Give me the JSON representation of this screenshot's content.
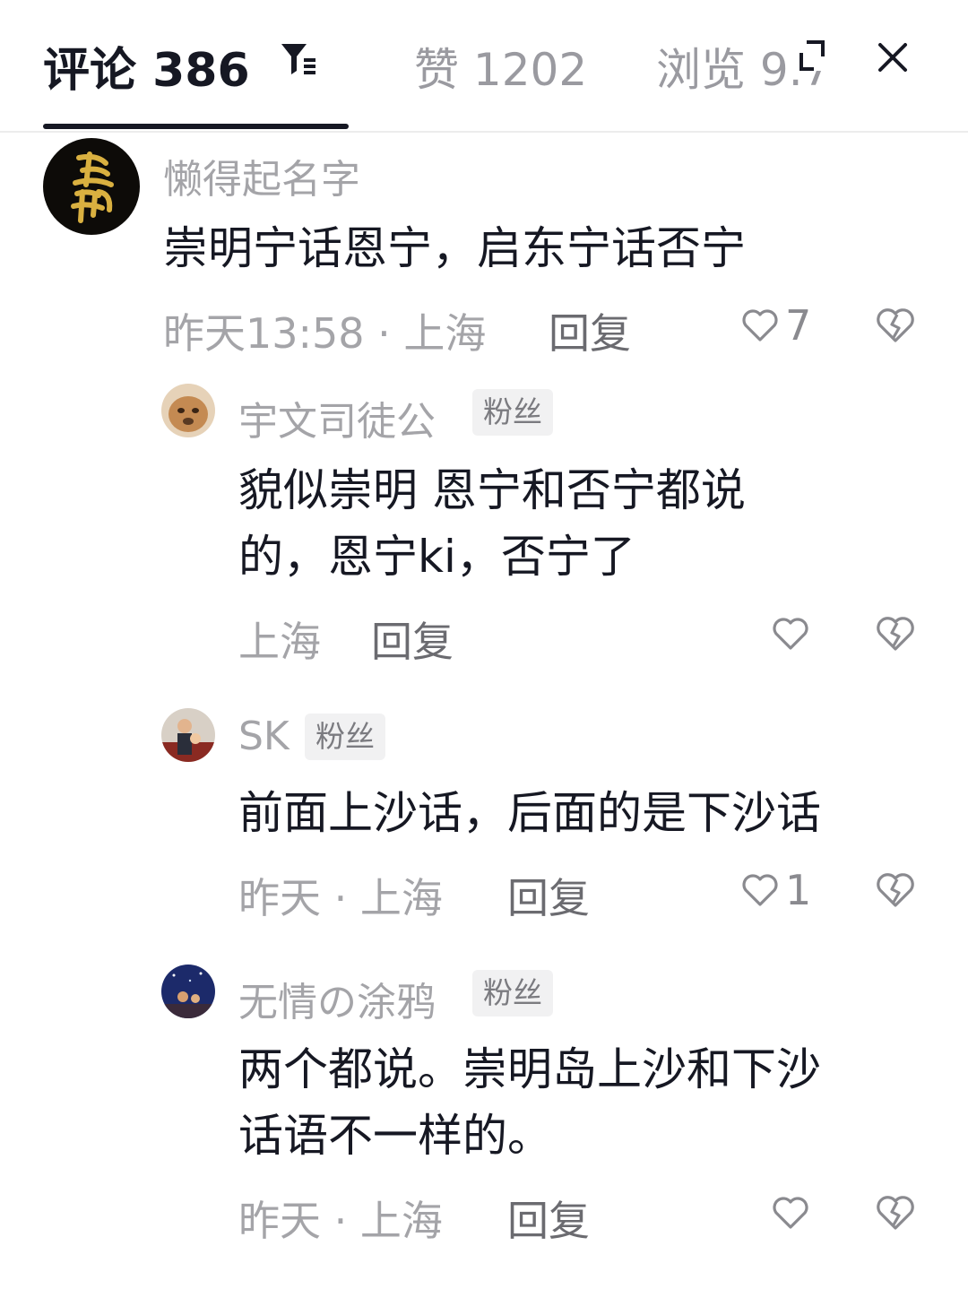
{
  "header": {
    "comments_tab": "评论 386",
    "likes_tab": "赞 1202",
    "views_tab": "浏览 9.7",
    "icons": [
      "filter-icon",
      "expand-icon",
      "close-icon"
    ]
  },
  "comments": [
    {
      "user": "懒得起名字",
      "text": "崇明宁话恩宁，启东宁话否宁",
      "meta": "昨天13:58 · 上海",
      "reply": "回复",
      "likes": "7"
    },
    {
      "user": "宇文司徒公",
      "badge": "粉丝",
      "text": "貌似崇明 恩宁和否宁都说\n的，恩宁ki，否宁了",
      "meta": "上海",
      "reply": "回复",
      "likes": ""
    },
    {
      "user": "SK",
      "badge": "粉丝",
      "text": "前面上沙话，后面的是下沙话",
      "meta": "昨天 · 上海",
      "reply": "回复",
      "likes": "1"
    },
    {
      "user": "无情の涂鸦",
      "badge": "粉丝",
      "text": "两个都说。崇明岛上沙和下沙\n话语不一样的。",
      "meta": "昨天 · 上海",
      "reply": "回复",
      "likes": ""
    }
  ],
  "colors": {
    "text_primary": "#161823",
    "text_secondary": "#a4a4a8",
    "badge_bg": "#f1f1f2",
    "divider": "#ececec"
  }
}
